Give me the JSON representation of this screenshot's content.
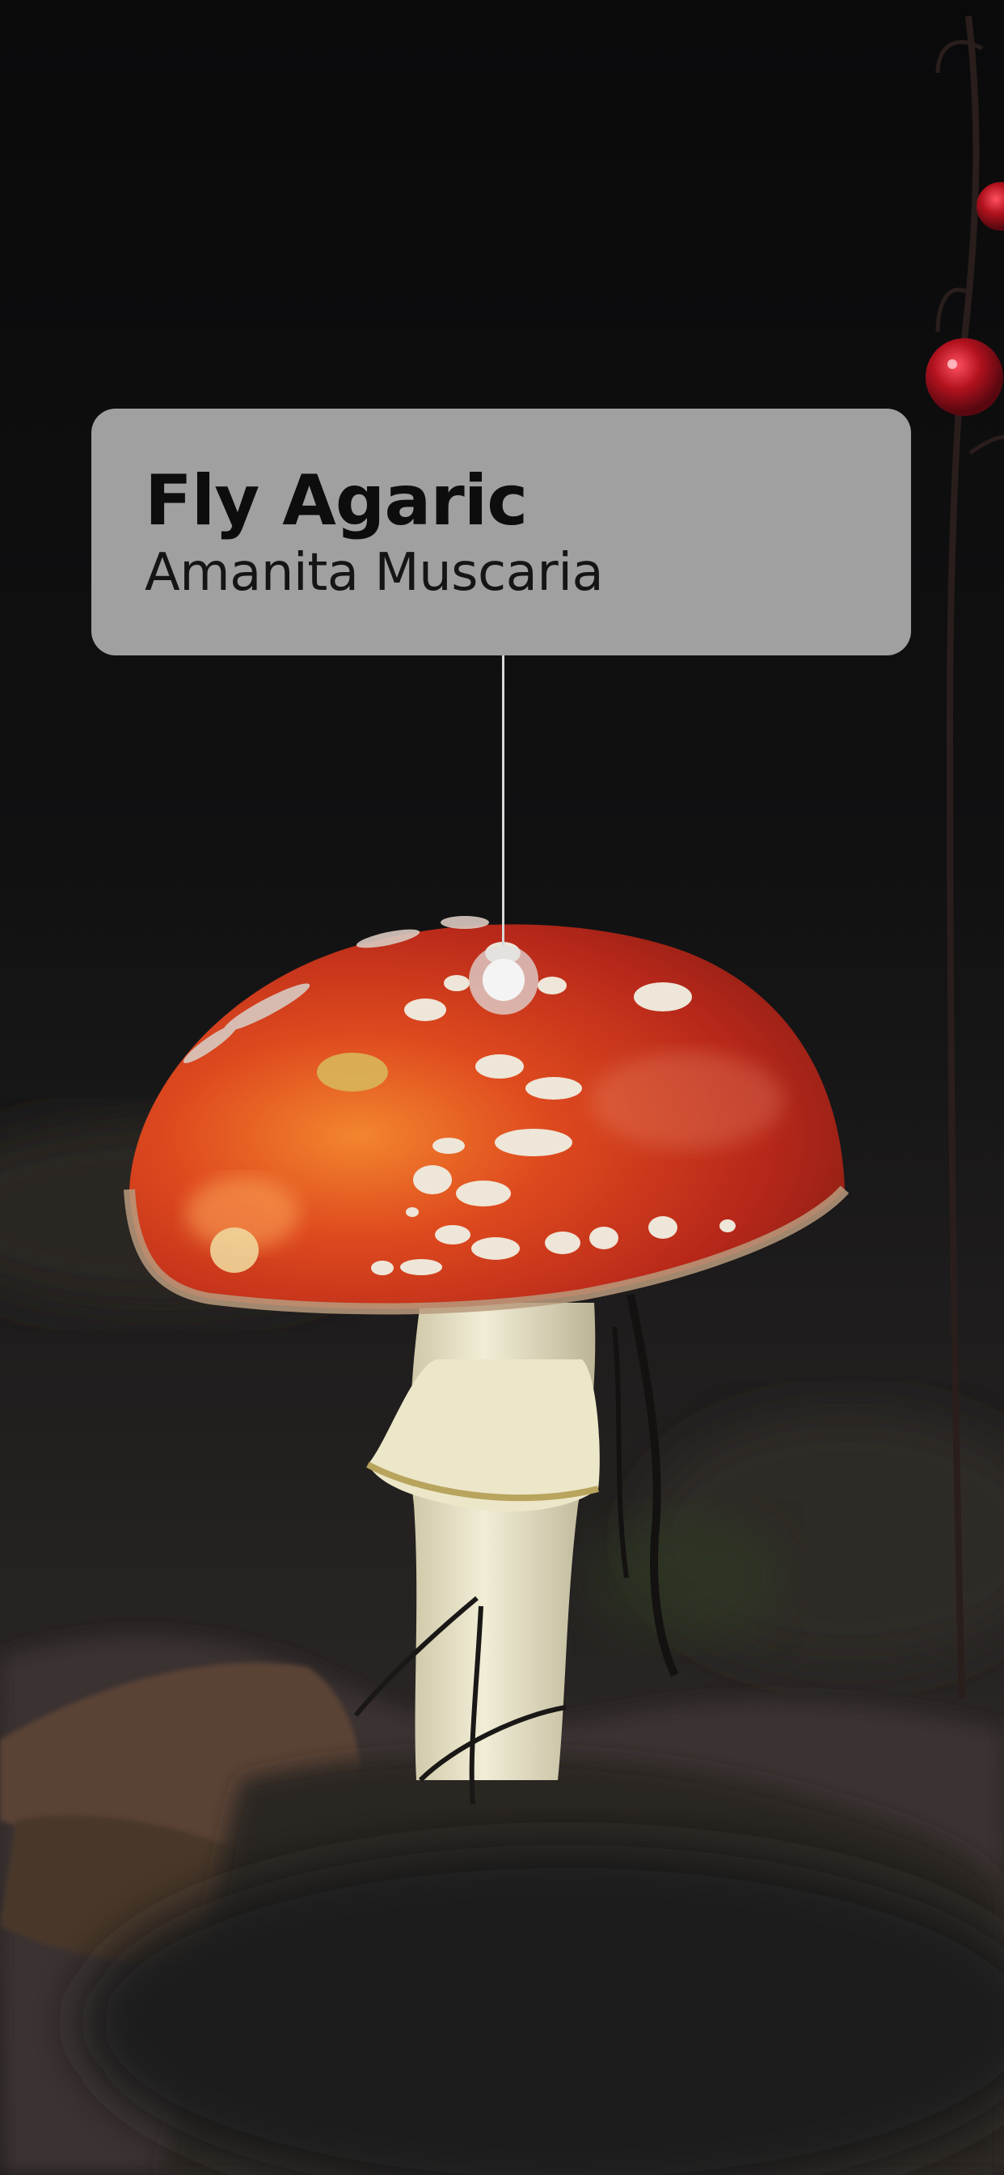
{
  "label": {
    "common_name": "Fly Agaric",
    "scientific_name": "Amanita Muscaria"
  },
  "photo": {
    "subject": "mushroom",
    "colors": {
      "cap": "#c8321c",
      "cap_highlight": "#f07a2c",
      "background": "#0c0c0d",
      "stem": "#e9e4c8",
      "berry": "#b0101c"
    }
  },
  "marker": {
    "style": "ring-dot",
    "color": "#f4f4f4"
  }
}
